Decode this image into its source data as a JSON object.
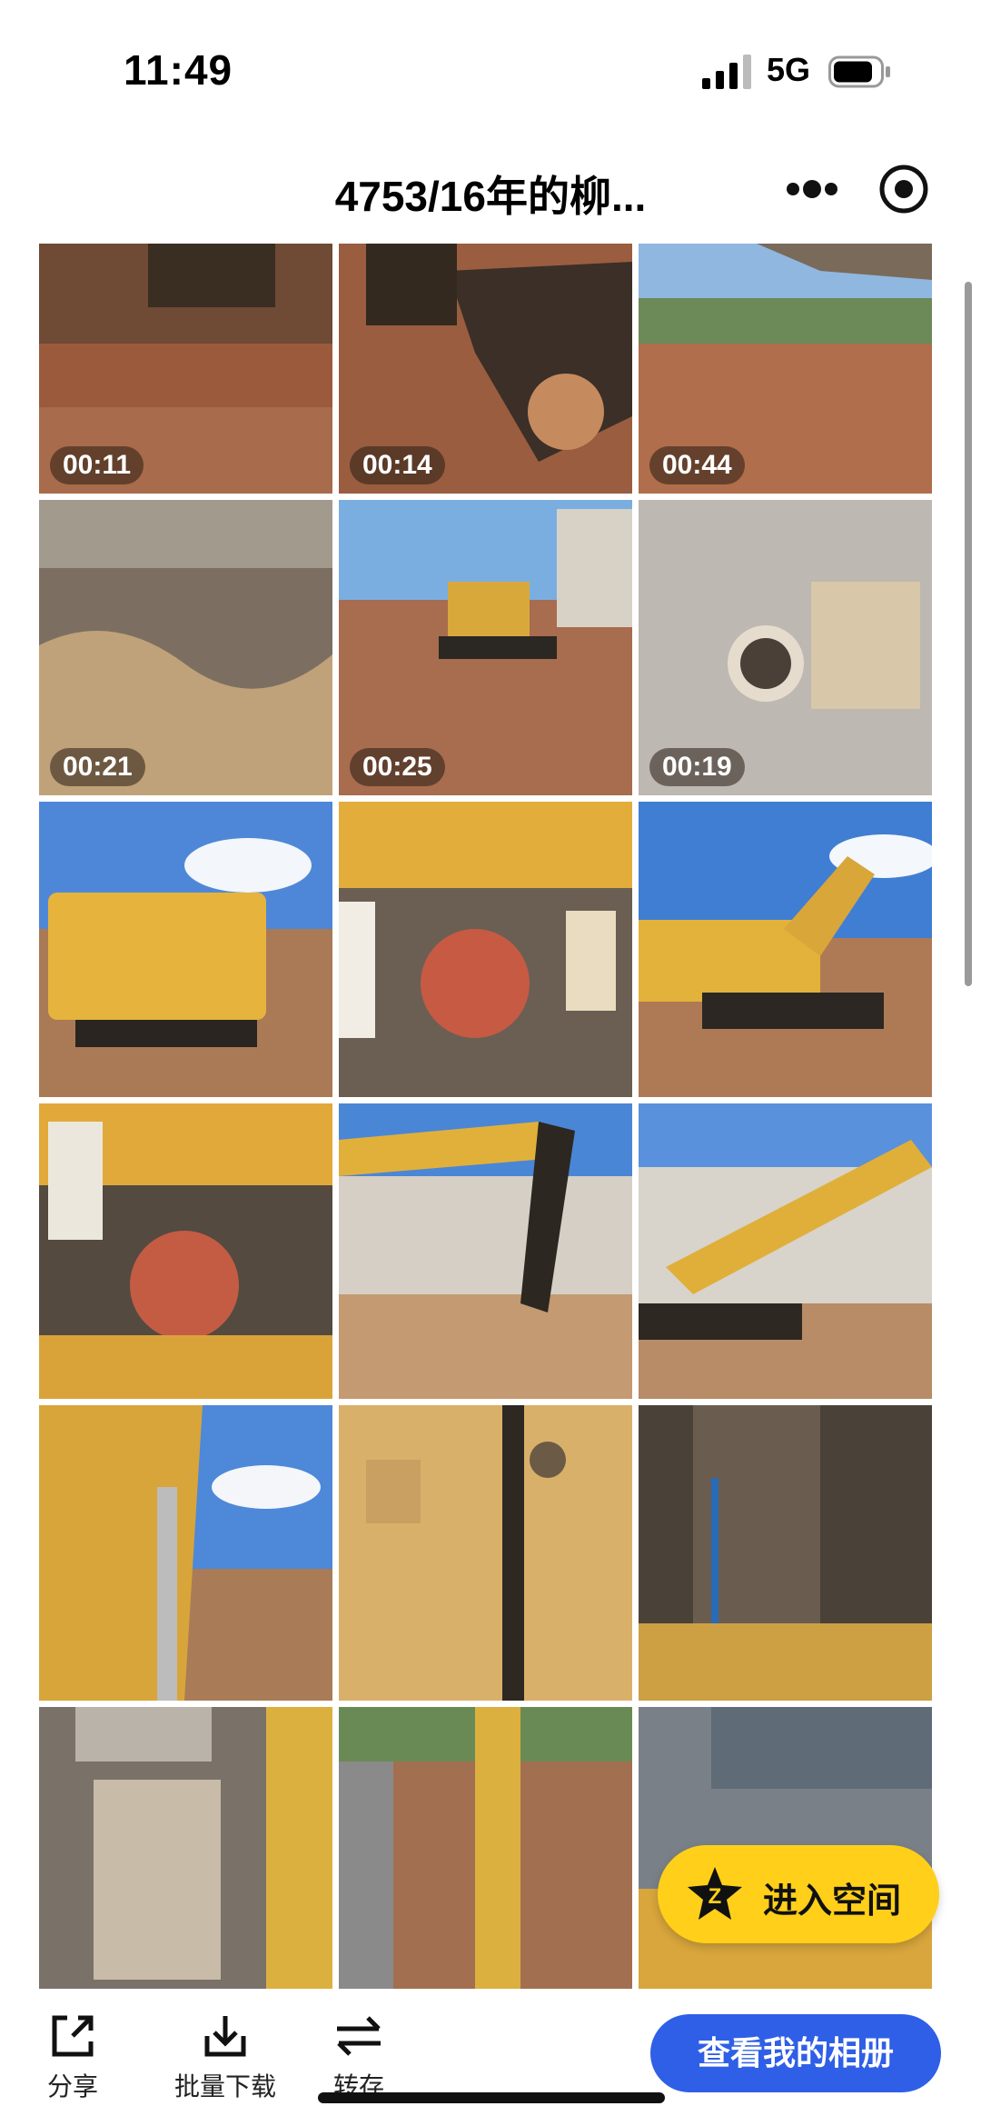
{
  "status_bar": {
    "time": "11:49",
    "network": "5G"
  },
  "header": {
    "title": "4753/16年的柳..."
  },
  "grid": {
    "tiles": [
      {
        "duration": "00:11"
      },
      {
        "duration": "00:14"
      },
      {
        "duration": "00:44"
      },
      {
        "duration": "00:21"
      },
      {
        "duration": "00:25"
      },
      {
        "duration": "00:19"
      },
      {},
      {},
      {},
      {},
      {},
      {},
      {},
      {},
      {},
      {},
      {},
      {}
    ]
  },
  "floating": {
    "enter_space": "进入空间"
  },
  "bottom_bar": {
    "share": "分享",
    "batch_download": "批量下载",
    "transfer": "转存",
    "view_album": "查看我的相册"
  },
  "colors": {
    "accent_blue": "#2f5fe6",
    "accent_yellow": "#ffcf1a"
  }
}
